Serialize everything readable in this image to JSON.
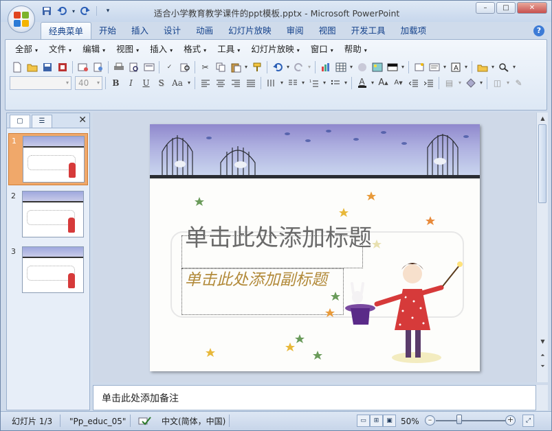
{
  "window": {
    "title": "适合小学教育教学课件的ppt模板.pptx - Microsoft PowerPoint",
    "controls": {
      "minimize": "–",
      "maximize": "□",
      "close": "✕"
    }
  },
  "qat": {
    "save_icon": "save-icon",
    "undo_icon": "undo-icon",
    "redo_icon": "redo-icon",
    "customize": "▾"
  },
  "tabs": [
    {
      "label": "经典菜单",
      "active": true
    },
    {
      "label": "开始"
    },
    {
      "label": "插入"
    },
    {
      "label": "设计"
    },
    {
      "label": "动画"
    },
    {
      "label": "幻灯片放映"
    },
    {
      "label": "审阅"
    },
    {
      "label": "视图"
    },
    {
      "label": "开发工具"
    },
    {
      "label": "加载项"
    }
  ],
  "menu": {
    "items": [
      {
        "label": "全部"
      },
      {
        "label": "文件"
      },
      {
        "label": "编辑"
      },
      {
        "label": "视图"
      },
      {
        "label": "插入"
      },
      {
        "label": "格式"
      },
      {
        "label": "工具"
      },
      {
        "label": "幻灯片放映"
      },
      {
        "label": "窗口"
      },
      {
        "label": "帮助"
      }
    ],
    "dropdown_arrow": "▾"
  },
  "toolbar": {
    "font_name": "",
    "font_size": "40",
    "bold": "B",
    "italic": "I",
    "underline": "U",
    "shadow": "S",
    "change_case": "Aa",
    "font_color": "A",
    "text_box": "A"
  },
  "thumbnails": [
    {
      "number": "1",
      "selected": true
    },
    {
      "number": "2"
    },
    {
      "number": "3"
    }
  ],
  "pane": {
    "close": "✕"
  },
  "slide": {
    "title_placeholder": "单击此处添加标题",
    "subtitle_placeholder": "单击此处添加副标题"
  },
  "notes": {
    "placeholder": "单击此处添加备注"
  },
  "status": {
    "slide_info": "幻灯片 1/3",
    "theme": "\"Pp_educ_05\"",
    "language": "中文(简体，中国)",
    "zoom": "50%",
    "zoom_fraction": 0.5
  },
  "colors": {
    "selected_thumb": "#f0a86a",
    "band_top": "#8f88cd",
    "subtitle": "#b28a3a",
    "girl_dress": "#d63a3a"
  }
}
